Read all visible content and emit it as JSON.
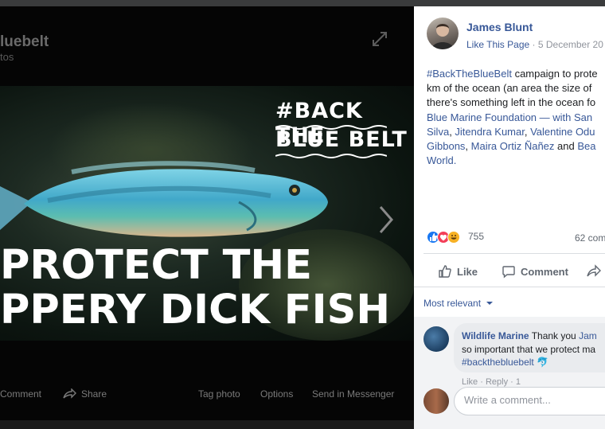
{
  "viewer": {
    "album_title": "luebelt",
    "album_subtitle": "tos",
    "photo": {
      "hashtag_line1": "#BACK THE",
      "hashtag_line2": "BLUE BELT",
      "headline_line1": "PROTECT THE",
      "headline_line2": "PPERY DICK FISH"
    },
    "actions": {
      "comment": "Comment",
      "share": "Share",
      "tag_photo": "Tag photo",
      "options": "Options",
      "send_in_messenger": "Send in Messenger"
    }
  },
  "post": {
    "author": "James Blunt",
    "like_page": "Like This Page",
    "separator": " · ",
    "date": "5 December 20",
    "text_hashtag": "#BackTheBlueBelt",
    "text_body_1": " campaign to prote",
    "text_body_2": "km of the ocean (an area the size of",
    "text_body_3": "there's something left in the ocean fo",
    "text_org": "Blue Marine Foundation",
    "text_with": " — with ",
    "text_name_san": "San",
    "text_name_silva": "Silva",
    "text_comma": ", ",
    "text_name_jitendra": "Jitendra Kumar",
    "text_name_valentine": "Valentine Odu",
    "text_name_gibbons": "Gibbons",
    "text_name_maira": "Maira Ortiz Ñañez",
    "text_and": " and ",
    "text_name_bea": "Bea",
    "text_world": "World",
    "text_period": ".",
    "reaction_count": "755",
    "comment_count": "62 com",
    "like_label": "Like",
    "comment_label": "Comment"
  },
  "comments": {
    "sort_label": "Most relevant",
    "first": {
      "author": "Wildlife Marine",
      "text_1": " Thank you ",
      "mention": "Jam",
      "text_2": "so important that we protect ma",
      "hashtag": "#backthebluebelt"
    },
    "meta": "Like · Reply · 1",
    "write_placeholder": "Write a comment..."
  },
  "colors": {
    "facebook_blue": "#385898",
    "like_blue": "#1877f2",
    "love_red": "#f33e58",
    "haha_yellow": "#f7b125"
  },
  "icons": {
    "expand": "expand-icon",
    "next": "chevron-right-icon",
    "share": "share-arrow-icon",
    "like": "thumbs-up-icon",
    "comment": "speech-bubble-icon",
    "dropdown": "caret-down-icon"
  }
}
